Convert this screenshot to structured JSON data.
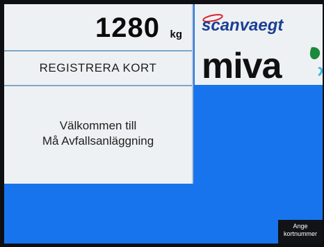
{
  "weight": {
    "value": "1280",
    "unit": "kg"
  },
  "register": {
    "label": "REGISTRERA KORT"
  },
  "welcome": {
    "line1": "Välkommen till",
    "line2": "Må Avfallsanläggning"
  },
  "logos": {
    "scanvaegt": "scanvaegt",
    "miva": "miva"
  },
  "card_button": {
    "line1": "Ange",
    "line2": "kortnummer"
  },
  "colors": {
    "screen_background": "#1874ec",
    "panel_background": "#eef1f3",
    "scanvaegt_red": "#d8232a",
    "scanvaegt_blue": "#1c3f95",
    "miva_text": "#101010",
    "miva_leaf": "#1a8a3a"
  },
  "icons": [
    "scanvaegt-logo",
    "miva-logo",
    "leaf-icon"
  ]
}
